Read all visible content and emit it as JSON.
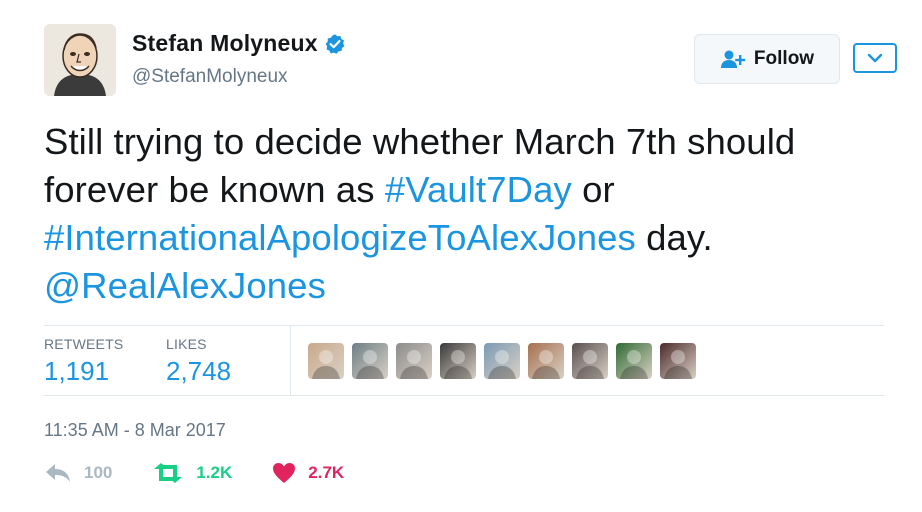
{
  "author": {
    "display_name": "Stefan Molyneux",
    "handle": "@StefanMolyneux",
    "verified": true,
    "avatar_icon": "cartoon-portrait-avatar"
  },
  "header": {
    "follow_label": "Follow",
    "follow_icon": "add-user-icon",
    "menu_icon": "chevron-down-icon"
  },
  "tweet": {
    "text_1": "Still trying to decide whether March 7th should forever be known as ",
    "link_1": "#Vault7Day",
    "text_2": " or ",
    "link_2": "#InternationalApologizeToAlexJones",
    "text_3": " day. ",
    "link_3": "@RealAlexJones"
  },
  "stats": {
    "retweets_label": "RETWEETS",
    "retweets_value": "1,191",
    "likes_label": "LIKES",
    "likes_value": "2,748"
  },
  "likers": [
    {
      "name": "liker-avatar-1",
      "color": "#c9a98a"
    },
    {
      "name": "liker-avatar-2",
      "color": "#6d7f86"
    },
    {
      "name": "liker-avatar-3",
      "color": "#8c8c8c"
    },
    {
      "name": "liker-avatar-4",
      "color": "#3a3a3a"
    },
    {
      "name": "liker-avatar-5",
      "color": "#7b9bb5"
    },
    {
      "name": "liker-avatar-6",
      "color": "#a7704f"
    },
    {
      "name": "liker-avatar-7",
      "color": "#5a4f4f"
    },
    {
      "name": "liker-avatar-8",
      "color": "#2f6b33"
    },
    {
      "name": "liker-avatar-9",
      "color": "#4b2a2a"
    }
  ],
  "timestamp": "11:35 AM - 8 Mar 2017",
  "actions": {
    "reply_count": "100",
    "retweet_count": "1.2K",
    "like_count": "2.7K"
  },
  "colors": {
    "link": "#1b95e0",
    "muted": "#657786",
    "retweet": "#19cf86",
    "like": "#e0245e",
    "reply": "#aab8c2"
  }
}
